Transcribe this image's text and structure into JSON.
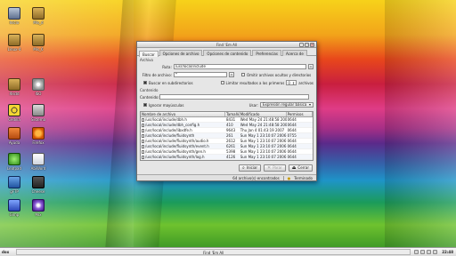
{
  "desktop": {
    "icons": [
      {
        "label": "Inicio",
        "icon": "home-icon"
      },
      {
        "label": "Mis_d",
        "icon": "box-icon"
      },
      {
        "label": "Linux-4",
        "icon": "box-icon"
      },
      {
        "label": "Mis_6",
        "icon": "box-icon"
      },
      {
        "label": "Xlsdd",
        "icon": "box-icon"
      },
      {
        "label": "ISO",
        "icon": "disc-icon"
      },
      {
        "label": "Cedilla",
        "icon": "radiation-icon"
      },
      {
        "label": "Sistema",
        "icon": "monitor-icon"
      },
      {
        "label": "Ayuda",
        "icon": "tools-icon"
      },
      {
        "label": "Firefox",
        "icon": "firefox-icon"
      },
      {
        "label": "Leafpad",
        "icon": "leaf-icon"
      },
      {
        "label": "AbiWord",
        "icon": "mail-icon"
      },
      {
        "label": "gFTP",
        "icon": "ftp-icon"
      },
      {
        "label": "Cheese",
        "icon": "camera-icon"
      },
      {
        "label": "Gimp",
        "icon": "app-icon"
      },
      {
        "label": "Mix",
        "icon": "purple-app-icon"
      }
    ]
  },
  "window": {
    "title": "Find 'Em All",
    "tabs": [
      "Buscar",
      "Opciones de archivo",
      "Opciones de contenido",
      "Preferencias",
      "Acerca de"
    ],
    "archive_group": "Archivo",
    "path_label": "Ruta:",
    "path_value": "/usr/local/include",
    "filter_label": "Filtro de archivo:",
    "filter_value": "*",
    "omit_hidden": "Omitir archivos ocultos y directorios",
    "search_subdirs": "Buscar en subdirectorios",
    "limit_label": "Limitar resultados a los primeros",
    "limit_value": "0",
    "limit_suffix": "archivos",
    "content_group": "Contenido",
    "contains_label": "Contenido:",
    "contains_value": "",
    "ignore_case": "Ignorar mayúsculas",
    "use_label": "Usar:",
    "regex_value": "Expresión regular básica",
    "columns": [
      "Nombre de archivo",
      "Tamaño",
      "Modificado",
      "Permisos"
    ],
    "rows": [
      {
        "name": "/usr/local/include/dbh.h",
        "size": "8431",
        "modified": "Wed May 24 21:48:58 2006",
        "perms": "0644"
      },
      {
        "name": "/usr/local/include/dbh_config.h",
        "size": "410",
        "modified": "Wed May 24 21:48:58 2006",
        "perms": "0644"
      },
      {
        "name": "/usr/local/include/libxdfe.h",
        "size": "9643",
        "modified": "Thu Jan 4 01:43:19 2007",
        "perms": "0644"
      },
      {
        "name": "/usr/local/include/fluidsynth",
        "size": "261",
        "modified": "Sun May 1 23:10:07 2006",
        "perms": "0755"
      },
      {
        "name": "/usr/local/include/fluidsynth/audio.h",
        "size": "2612",
        "modified": "Sun May 1 23:10:07 2006",
        "perms": "0644"
      },
      {
        "name": "/usr/local/include/fluidsynth/event.h",
        "size": "6261",
        "modified": "Sun May 1 23:10:07 2006",
        "perms": "0644"
      },
      {
        "name": "/usr/local/include/fluidsynth/gen.h",
        "size": "5398",
        "modified": "Sun May 1 23:10:07 2006",
        "perms": "0644"
      },
      {
        "name": "/usr/local/include/fluidsynth/log.h",
        "size": "4126",
        "modified": "Sun May 1 23:10:07 2006",
        "perms": "0644"
      }
    ],
    "buttons": {
      "start": "Iniciar",
      "stop": "Parar",
      "close": "Cerrar"
    },
    "status_found": "64 archivo(s) encontrados",
    "status_done": "Terminado"
  },
  "taskbar": {
    "start_label": "dox",
    "window_button": "Find 'Em All",
    "clock": "22:48"
  }
}
